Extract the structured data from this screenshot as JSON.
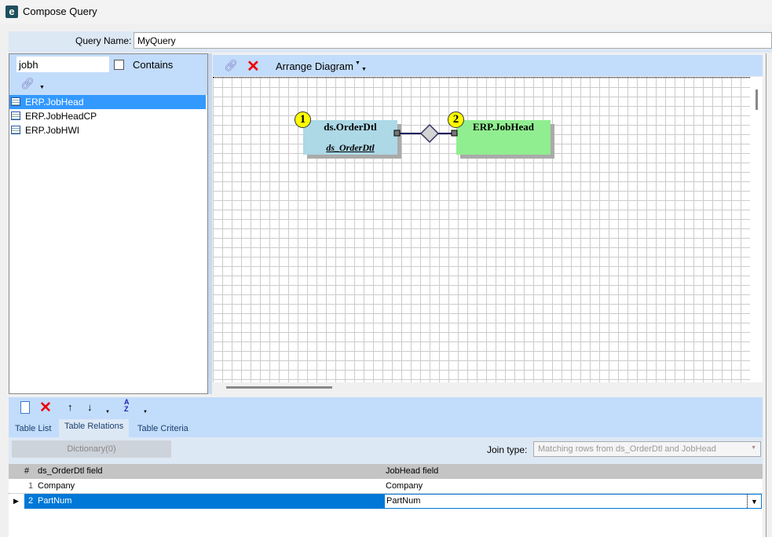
{
  "window": {
    "title": "Compose Query"
  },
  "query": {
    "label": "Query Name:",
    "value": "MyQuery"
  },
  "table_search": {
    "value": "jobh",
    "contains_label": "Contains"
  },
  "table_list": [
    {
      "name": "ERP.JobHead",
      "selected": true
    },
    {
      "name": "ERP.JobHeadCP"
    },
    {
      "name": "ERP.JobHWI"
    }
  ],
  "diagram": {
    "arrange_label": "Arrange Diagram",
    "nodes": [
      {
        "badge": "1",
        "title": "ds.OrderDtl",
        "alias": "ds_OrderDtl",
        "color": "#add8e6"
      },
      {
        "badge": "2",
        "title": "ERP.JobHead",
        "color": "#90ee90"
      }
    ]
  },
  "tabs": [
    "Table List",
    "Table Relations",
    "Table Criteria"
  ],
  "relations": {
    "dictionary_label": "Dictionary(0)",
    "join_label": "Join type:",
    "join_value": "Matching rows from ds_OrderDtl and JobHead",
    "columns": [
      "#",
      "ds_OrderDtl field",
      "JobHead field"
    ],
    "rows": [
      {
        "num": "1",
        "left": "Company",
        "right": "Company"
      },
      {
        "num": "2",
        "left": "PartNum",
        "right": "PartNum"
      }
    ]
  }
}
